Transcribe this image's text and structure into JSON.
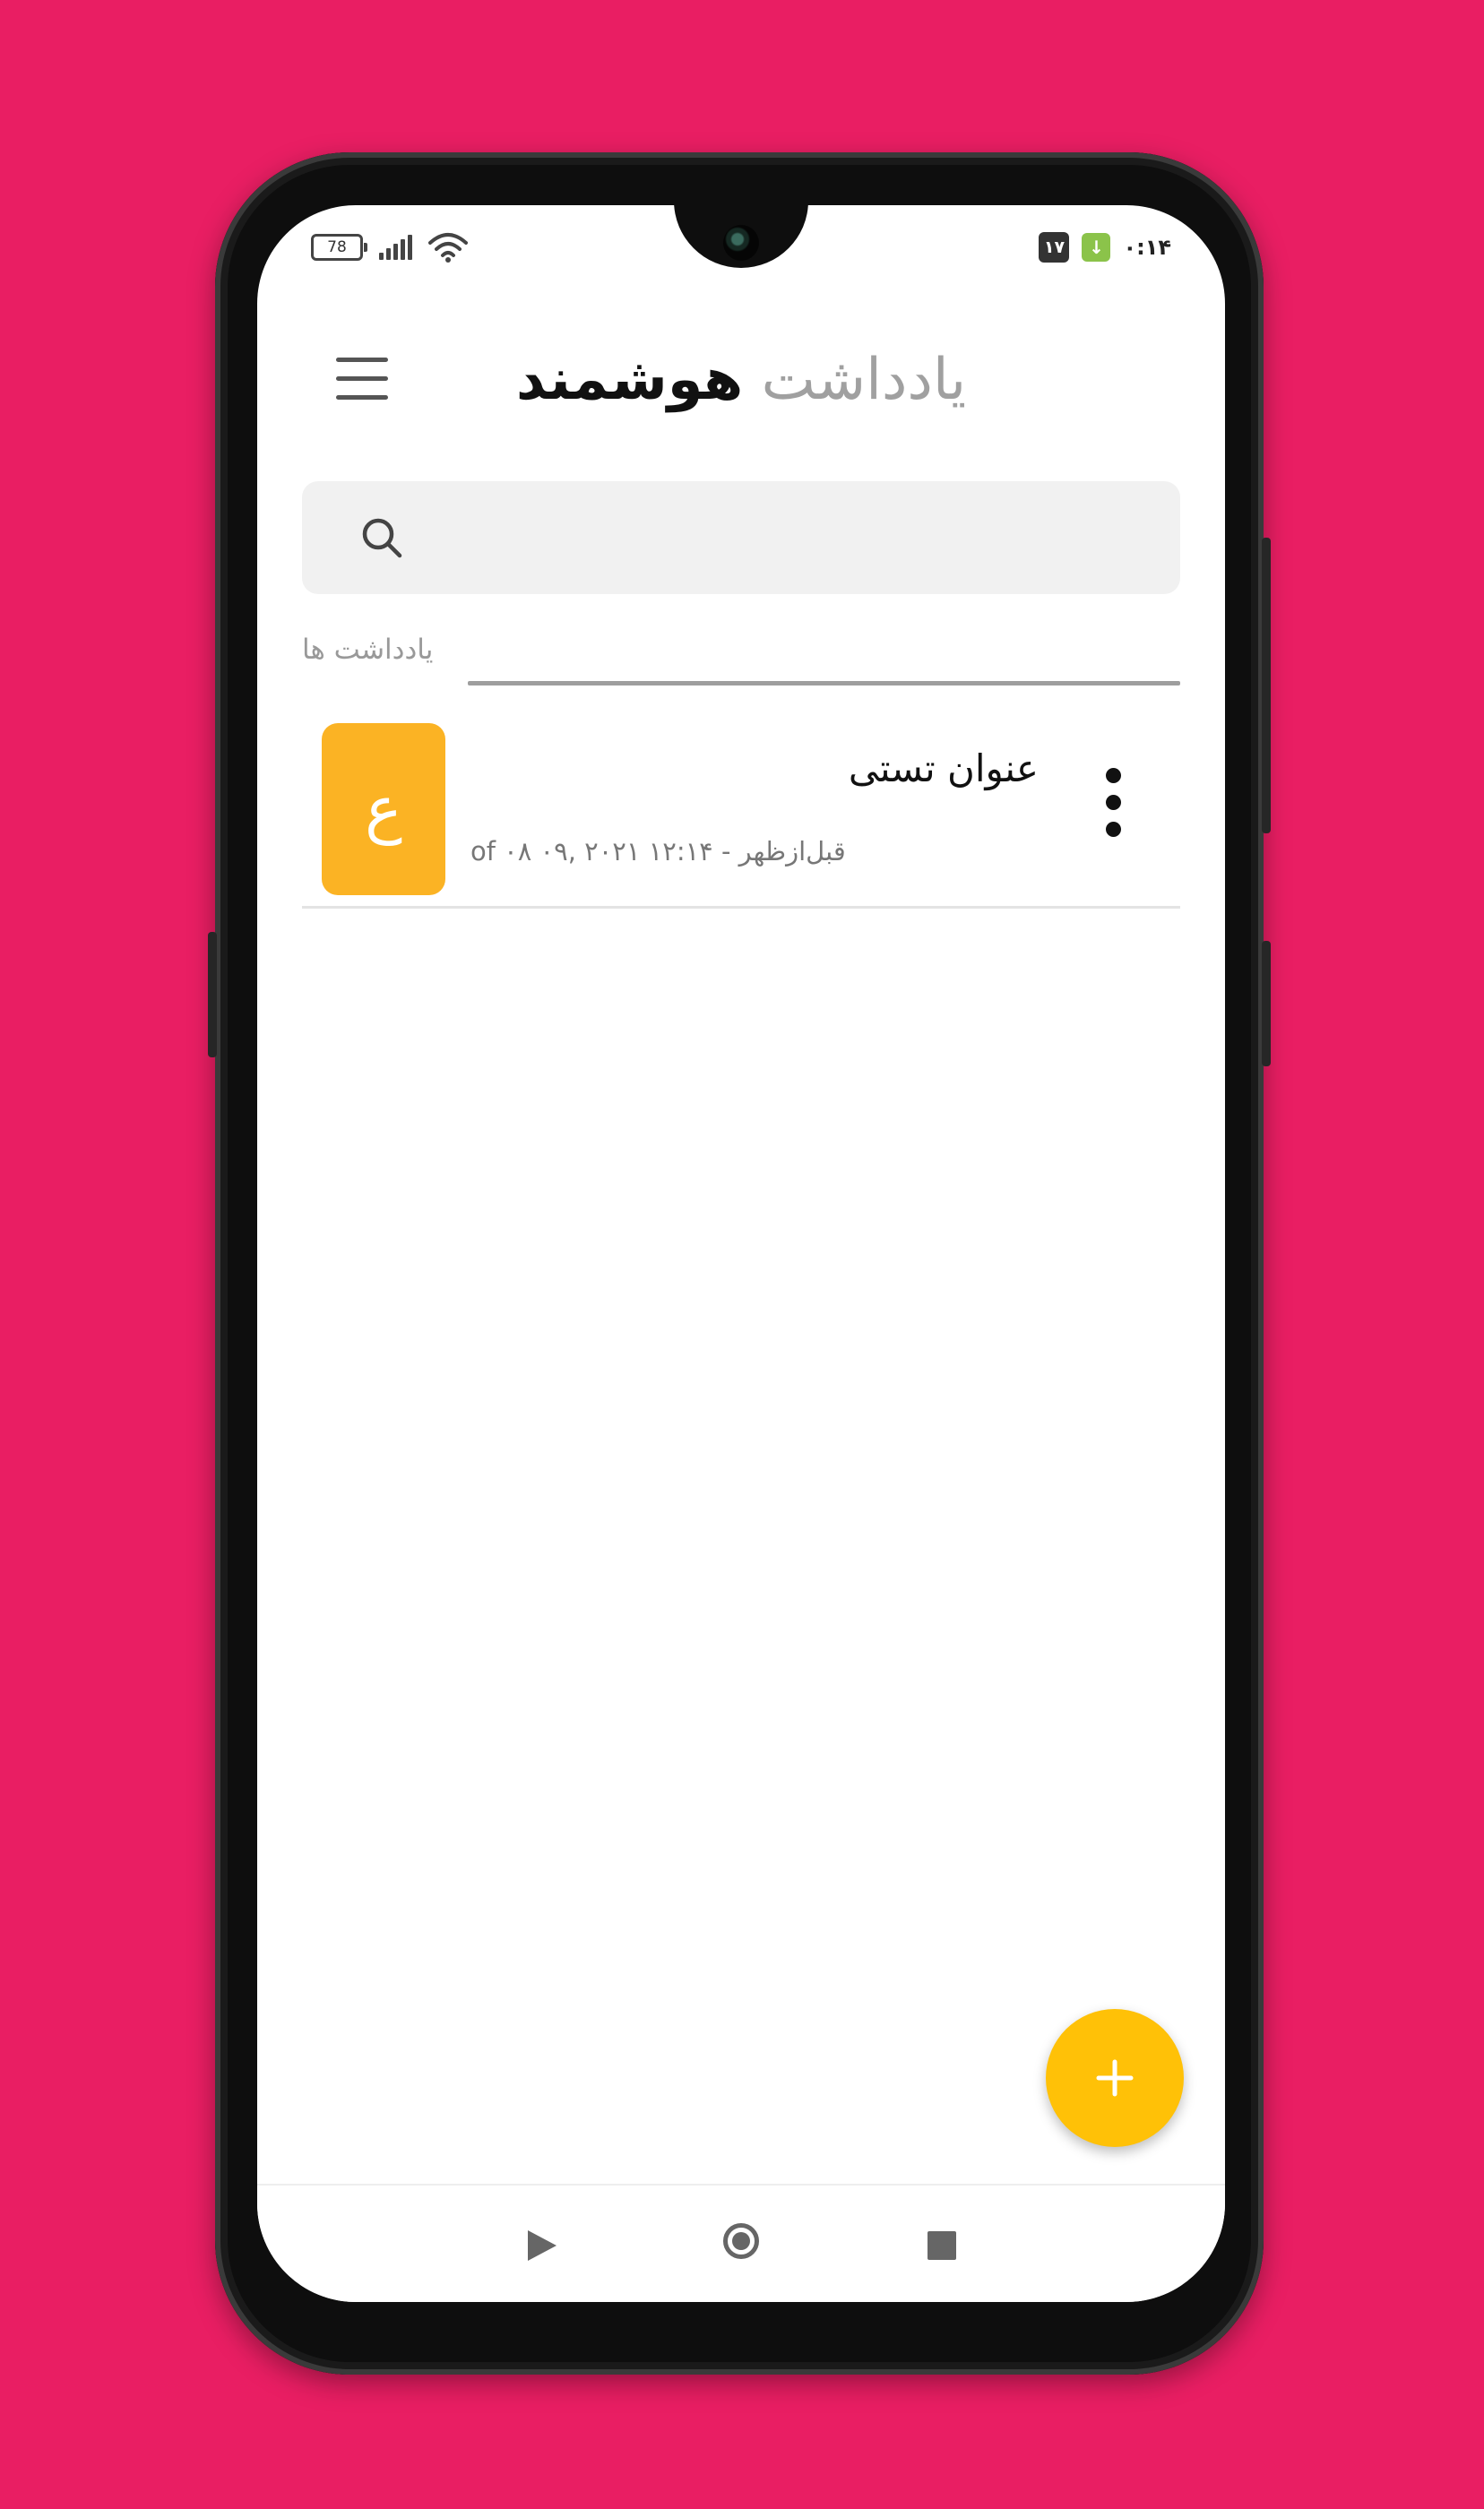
{
  "status_bar": {
    "battery": "78",
    "notification_badge": "۱۷",
    "clock": "۰:۱۴"
  },
  "header": {
    "title_light": "یادداشت",
    "title_bold": "هوشمند"
  },
  "search": {
    "placeholder": "",
    "value": ""
  },
  "section": {
    "label": "یادداشت ها"
  },
  "notes": [
    {
      "initial": "ع",
      "title": "عنوان تستی",
      "date": "قبل‌ازظهر - ۱۲:۱۴ ۲۰۲۱ ,۰۹ of ۰۸"
    }
  ],
  "colors": {
    "background": "#E91E63",
    "note_avatar": "#FBB324",
    "fab": "#FFC107"
  },
  "icons": {
    "menu": "hamburger-icon",
    "search": "search-icon",
    "more": "more-vertical-icon",
    "add": "plus-icon"
  }
}
